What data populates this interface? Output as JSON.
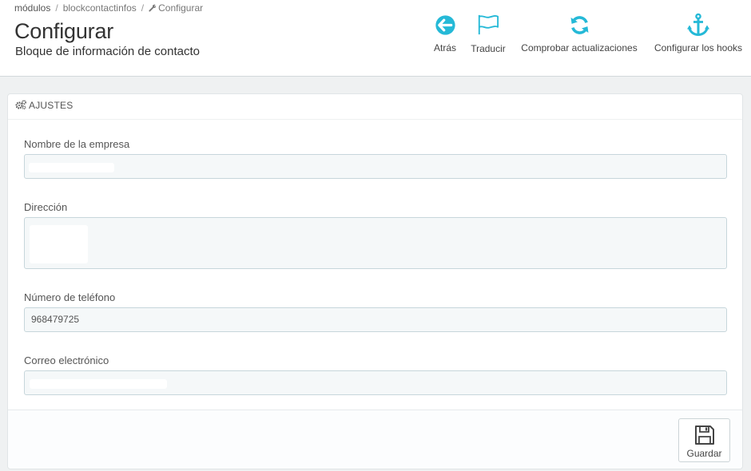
{
  "breadcrumb": {
    "items": [
      "módulos",
      "blockcontactinfos",
      "Configurar"
    ]
  },
  "header": {
    "title": "Configurar",
    "subtitle": "Bloque de información de contacto"
  },
  "toolbar": {
    "back_label": "Atrás",
    "translate_label": "Traducir",
    "check_updates_label": "Comprobar actualizaciones",
    "hooks_label": "Configurar los hooks"
  },
  "panel": {
    "heading": "AJUSTES",
    "fields": {
      "company": {
        "label": "Nombre de la empresa",
        "value": ""
      },
      "address": {
        "label": "Dirección",
        "value": ""
      },
      "phone": {
        "label": "Número de teléfono",
        "value": "968479725"
      },
      "email": {
        "label": "Correo electrónico",
        "value": ""
      }
    },
    "save_label": "Guardar"
  },
  "icons": {
    "back": "arrow-left-circle-icon",
    "translate": "flag-icon",
    "check_updates": "refresh-icon",
    "hooks": "anchor-icon",
    "settings": "cogs-icon",
    "save": "floppy-disk-icon",
    "breadcrumb_configure": "wrench-icon"
  },
  "colors": {
    "accent": "#25b9d7",
    "field_bg": "#f5f8f9",
    "field_border": "#c7d6db"
  }
}
